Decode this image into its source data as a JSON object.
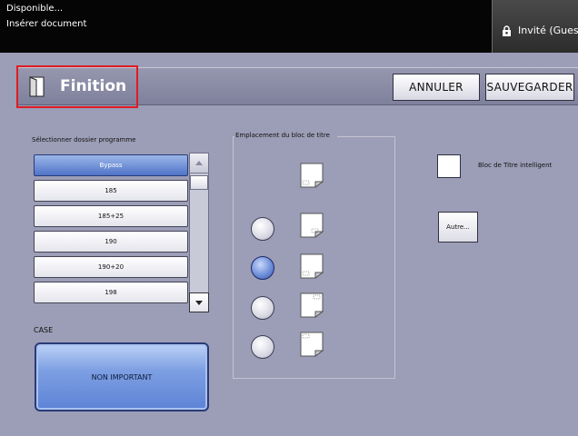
{
  "status": {
    "line1": "Disponible...",
    "line2": "Insérer document"
  },
  "user": {
    "label": "Invité (Guest"
  },
  "header": {
    "title": "Finition",
    "cancel_label": "ANNULER",
    "save_label": "SAUVEGARDER"
  },
  "program_list": {
    "label": "Sélectionner dossier programme",
    "items": [
      {
        "label": "Bypass",
        "selected": true
      },
      {
        "label": "185",
        "selected": false
      },
      {
        "label": "185+25",
        "selected": false
      },
      {
        "label": "190",
        "selected": false
      },
      {
        "label": "190+20",
        "selected": false
      },
      {
        "label": "198",
        "selected": false
      }
    ]
  },
  "case": {
    "label": "CASE",
    "value": "NON IMPORTANT"
  },
  "title_block": {
    "label": "Emplacement du bloc de titre",
    "selected_index": 1
  },
  "smart_title": {
    "label": "Bloc de Titre intelligent",
    "checked": false
  },
  "other_button": {
    "label": "Autre..."
  },
  "colors": {
    "background": "#9c9db6",
    "selected_blue": "#4f73c8",
    "highlight_red": "#e01b22"
  },
  "icons": {
    "user": "lock-user-icon",
    "title": "door-icon",
    "doc": "document-folded-corner-icon"
  }
}
